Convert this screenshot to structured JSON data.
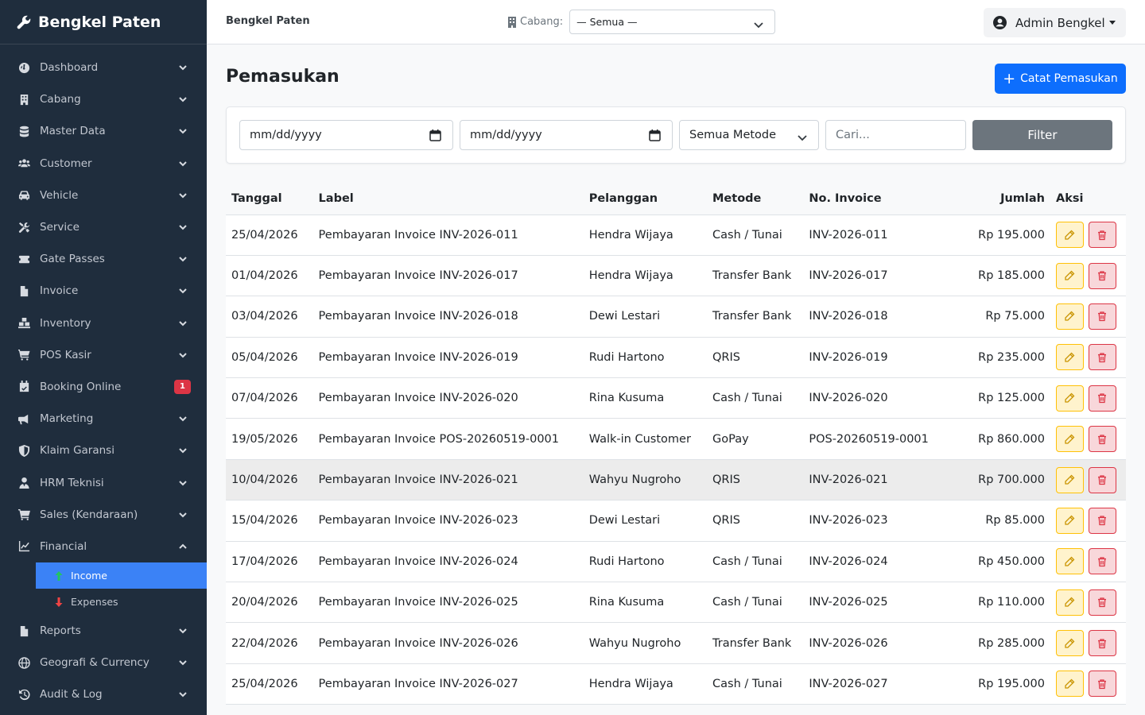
{
  "brand": {
    "name": "Bengkel Paten",
    "icon": "wrench-icon"
  },
  "sidebar": {
    "items": [
      {
        "label": "Dashboard",
        "icon": "dashboard-icon",
        "has_chevron": false
      },
      {
        "label": "Cabang",
        "icon": "building-icon",
        "has_chevron": true
      },
      {
        "label": "Master Data",
        "icon": "database-icon",
        "has_chevron": true
      },
      {
        "label": "Customer",
        "icon": "users-icon",
        "has_chevron": true
      },
      {
        "label": "Vehicle",
        "icon": "car-icon",
        "has_chevron": true
      },
      {
        "label": "Service",
        "icon": "tools-icon",
        "has_chevron": true
      },
      {
        "label": "Gate Passes",
        "icon": "ticket-icon",
        "has_chevron": true
      },
      {
        "label": "Invoice",
        "icon": "file-invoice-icon",
        "has_chevron": true
      },
      {
        "label": "Inventory",
        "icon": "boxes-icon",
        "has_chevron": true
      },
      {
        "label": "POS Kasir",
        "icon": "cash-register-icon",
        "has_chevron": true
      },
      {
        "label": "Booking Online",
        "icon": "calendar-check-icon",
        "badge": "1"
      },
      {
        "label": "Marketing",
        "icon": "bullhorn-icon",
        "has_chevron": true
      },
      {
        "label": "Klaim Garansi",
        "icon": "shield-icon",
        "has_chevron": false
      },
      {
        "label": "HRM Teknisi",
        "icon": "user-tie-icon",
        "has_chevron": true
      },
      {
        "label": "Sales (Kendaraan)",
        "icon": "cart-icon",
        "has_chevron": true
      },
      {
        "label": "Financial",
        "icon": "chart-line-icon",
        "has_chevron": true,
        "expanded": true
      }
    ],
    "financial_sub": [
      {
        "label": "Income",
        "icon": "arrow-up-icon",
        "active": true
      },
      {
        "label": "Expenses",
        "icon": "arrow-down-icon",
        "active": false
      }
    ],
    "bottom_items": [
      {
        "label": "Reports",
        "icon": "file-alt-icon"
      },
      {
        "label": "Geografi & Currency",
        "icon": "globe-icon"
      },
      {
        "label": "Audit & Log",
        "icon": "history-icon"
      }
    ]
  },
  "topbar": {
    "title": "Bengkel Paten",
    "branch_label": "Cabang:",
    "branch_value": "— Semua —",
    "user_name": "Admin Bengkel"
  },
  "page": {
    "title": "Pemasukan",
    "add_button": "Catat Pemasukan"
  },
  "filters": {
    "date_from": "mm/dd/yyyy",
    "date_to": "mm/dd/yyyy",
    "method": "Semua Metode",
    "search_placeholder": "Cari...",
    "filter_button": "Filter"
  },
  "table": {
    "columns": [
      "Tanggal",
      "Label",
      "Pelanggan",
      "Metode",
      "No. Invoice",
      "Jumlah",
      "Aksi"
    ],
    "rows": [
      [
        "25/04/2026",
        "Pembayaran Invoice INV-2026-011",
        "Hendra Wijaya",
        "Cash / Tunai",
        "INV-2026-011",
        "Rp 195.000"
      ],
      [
        "01/04/2026",
        "Pembayaran Invoice INV-2026-017",
        "Hendra Wijaya",
        "Transfer Bank",
        "INV-2026-017",
        "Rp 185.000"
      ],
      [
        "03/04/2026",
        "Pembayaran Invoice INV-2026-018",
        "Dewi Lestari",
        "Transfer Bank",
        "INV-2026-018",
        "Rp 75.000"
      ],
      [
        "05/04/2026",
        "Pembayaran Invoice INV-2026-019",
        "Rudi Hartono",
        "QRIS",
        "INV-2026-019",
        "Rp 235.000"
      ],
      [
        "07/04/2026",
        "Pembayaran Invoice INV-2026-020",
        "Rina Kusuma",
        "Cash / Tunai",
        "INV-2026-020",
        "Rp 125.000"
      ],
      [
        "19/05/2026",
        "Pembayaran Invoice POS-20260519-0001",
        "Walk-in Customer",
        "GoPay",
        "POS-20260519-0001",
        "Rp 860.000"
      ],
      [
        "10/04/2026",
        "Pembayaran Invoice INV-2026-021",
        "Wahyu Nugroho",
        "QRIS",
        "INV-2026-021",
        "Rp 700.000"
      ],
      [
        "15/04/2026",
        "Pembayaran Invoice INV-2026-023",
        "Dewi Lestari",
        "QRIS",
        "INV-2026-023",
        "Rp 85.000"
      ],
      [
        "17/04/2026",
        "Pembayaran Invoice INV-2026-024",
        "Rudi Hartono",
        "Cash / Tunai",
        "INV-2026-024",
        "Rp 450.000"
      ],
      [
        "20/04/2026",
        "Pembayaran Invoice INV-2026-025",
        "Rina Kusuma",
        "Cash / Tunai",
        "INV-2026-025",
        "Rp 110.000"
      ],
      [
        "22/04/2026",
        "Pembayaran Invoice INV-2026-026",
        "Wahyu Nugroho",
        "Transfer Bank",
        "INV-2026-026",
        "Rp 285.000"
      ],
      [
        "25/04/2026",
        "Pembayaran Invoice INV-2026-027",
        "Hendra Wijaya",
        "Cash / Tunai",
        "INV-2026-027",
        "Rp 195.000"
      ]
    ],
    "hovered_row": 6
  },
  "colors": {
    "sidebar_bg": "#1f2d3d",
    "primary": "#0d6efd",
    "active_sub": "#3b82f6",
    "danger": "#dc3545",
    "warning": "#ffc107"
  }
}
